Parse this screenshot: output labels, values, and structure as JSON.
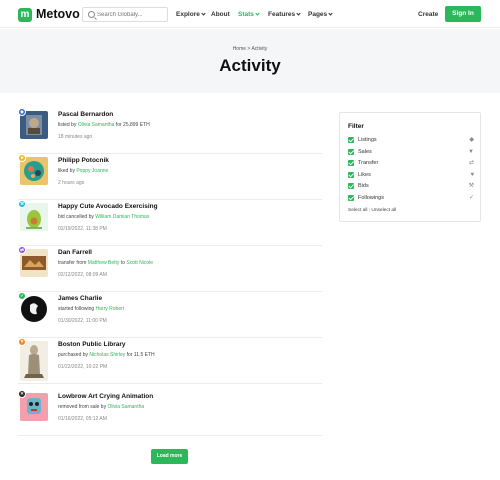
{
  "header": {
    "logo_mark": "m",
    "logo_text": "Metovo",
    "search_placeholder": "Search Globaly...",
    "nav": {
      "explore": "Explore",
      "about": "About",
      "stats": "Stats",
      "features": "Features",
      "pages": "Pages"
    },
    "create": "Create",
    "signin": "Sign In"
  },
  "hero": {
    "breadcrumb_home": "Home",
    "breadcrumb_sep": ">",
    "breadcrumb_current": "Activity",
    "title": "Activity"
  },
  "activities": [
    {
      "title": "Pascal Bernardon",
      "pre": "listed by ",
      "link1": "Olivia Samantha",
      "mid": " for 25.899 ETH",
      "link2": "",
      "post": "",
      "time": "18 minutes ago",
      "badge_icon": "tag-icon",
      "badge_color": "#2f6bd8"
    },
    {
      "title": "Philipp Potocnik",
      "pre": "liked by ",
      "link1": "Poppy Joanne",
      "mid": "",
      "link2": "",
      "post": "",
      "time": "2 hours ago",
      "badge_icon": "star-icon",
      "badge_color": "#f2b705"
    },
    {
      "title": "Happy Cute Avocado Exercising",
      "pre": "bid cancelled by ",
      "link1": "William Damian Thomas",
      "mid": "",
      "link2": "",
      "post": "",
      "time": "02/19/2022, 11:38 PM",
      "badge_icon": "gavel-icon",
      "badge_color": "#1fb6d8"
    },
    {
      "title": "Dan Farrell",
      "pre": "transfer from ",
      "link1": "Matthew Betty",
      "mid": " to ",
      "link2": "Scott Nicole",
      "post": "",
      "time": "02/12/2022, 08:09 AM",
      "badge_icon": "transfer-icon",
      "badge_color": "#8a4fd8"
    },
    {
      "title": "James Charlie",
      "pre": "started following ",
      "link1": "Harry Robert",
      "mid": "",
      "link2": "",
      "post": "",
      "time": "01/30/2022, 11:00 PM",
      "badge_icon": "check-icon",
      "badge_color": "#2bb85b"
    },
    {
      "title": "Boston Public Library",
      "pre": "purchased by ",
      "link1": "Nicholas Shirley",
      "mid": " for 11.5 ETH",
      "link2": "",
      "post": "",
      "time": "01/22/2022, 10:22 PM",
      "badge_icon": "cart-icon",
      "badge_color": "#f08a1c"
    },
    {
      "title": "Lowbrow Art Crying Animation",
      "pre": "removed from sale by ",
      "link1": "Olivia Samantha",
      "mid": "",
      "link2": "",
      "post": "",
      "time": "01/16/2022, 05:12 AM",
      "badge_icon": "close-icon",
      "badge_color": "#222222"
    }
  ],
  "load_more": "Load more",
  "filter": {
    "title": "Filter",
    "items": [
      {
        "label": "Listings",
        "icon": "tag-icon",
        "glyph": "◆"
      },
      {
        "label": "Sales",
        "icon": "cart-icon",
        "glyph": "▼"
      },
      {
        "label": "Transfer",
        "icon": "transfer-icon",
        "glyph": "⇄"
      },
      {
        "label": "Likes",
        "icon": "heart-icon",
        "glyph": "♥"
      },
      {
        "label": "Bids",
        "icon": "gavel-icon",
        "glyph": "⚒"
      },
      {
        "label": "Followings",
        "icon": "check-icon",
        "glyph": "✓"
      }
    ],
    "select_all": "Select all",
    "separator": "|",
    "unselect_all": "Unselect all"
  },
  "colors": {
    "accent": "#2bb85b",
    "hero_bg": "#f4f6f8"
  }
}
